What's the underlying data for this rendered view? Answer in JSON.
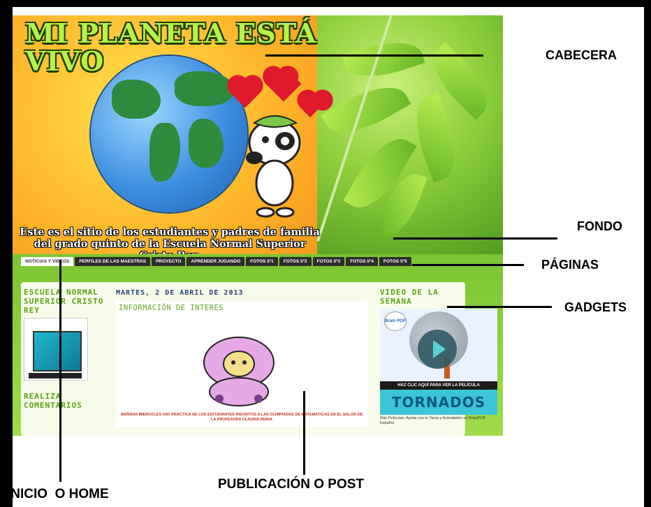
{
  "blog": {
    "title_line1": "MI PLANETA ESTÁ",
    "title_line2": "VIVO",
    "tagline_line1": "Este es el sitio de los estudiantes y padres de familia",
    "tagline_line2": "del grado quinto de la Escuela Normal Superior Cristo Rey."
  },
  "tabs": [
    {
      "label": "NOTICIAS Y VIDEOS",
      "active": true
    },
    {
      "label": "PERFILES DE LAS MAESTRAS"
    },
    {
      "label": "PROYECTO"
    },
    {
      "label": "APRENDER JUGANDO"
    },
    {
      "label": "FOTOS 5º1"
    },
    {
      "label": "FOTOS 5º2"
    },
    {
      "label": "FOTOS 5º3"
    },
    {
      "label": "FOTOS 5º4"
    },
    {
      "label": "FOTOS 5º5"
    }
  ],
  "sidebar_left": {
    "title": "ESCUELA NORMAL SUPERIOR CRISTO REY",
    "gadget2_title": "REALIZA COMENTARIOS"
  },
  "post": {
    "date": "MARTES, 2 DE ABRIL DE 2013",
    "title": "INFORMACIÓN DE INTERES",
    "text": "MAÑANA MIERCOLES HAY PRÁCTICA DE LOS ESTUDIANTES INSCRITOS A LAS OLIMPIADAS DE MATEMÁTICAS EN EL SALON DE LA PROFESORA CLAUDIA REINA"
  },
  "sidebar_right": {
    "title": "VIDEO DE LA SEMANA",
    "video_logo": "Brain POP",
    "video_strip": "HAZ CLIC AQUÍ PARA VER LA PELÍCULA",
    "video_title": "TORNADOS",
    "caption": "Más Películas: Ayuda con tu Tarea y Actividades en BrainPOP Español"
  },
  "annotations": {
    "cabecera": "CABECERA",
    "fondo": "FONDO",
    "paginas": "PÁGINAS",
    "gadgets": "GADGETS",
    "inicio": "INICIO  O HOME",
    "publicacion": "PUBLICACIÓN O POST"
  }
}
